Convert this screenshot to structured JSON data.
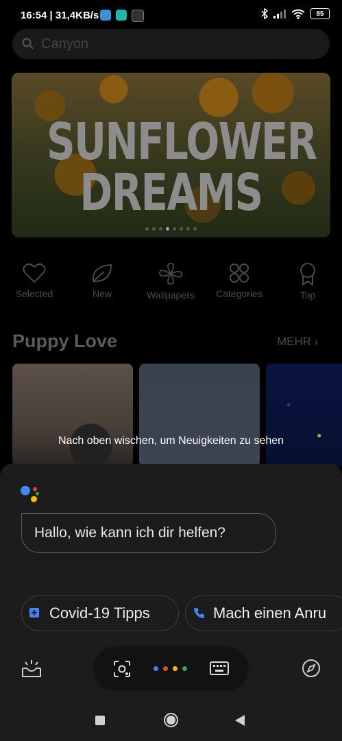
{
  "status_bar": {
    "time": "16:54",
    "speed": "| 31,4KB/s",
    "battery": "85"
  },
  "search": {
    "placeholder": "Canyon"
  },
  "banner": {
    "line1": "SUNFLOWER",
    "line2": "DREAMS",
    "page_count": 8,
    "active_page": 3
  },
  "quick_nav": [
    {
      "label": "Selected",
      "icon": "heart-icon"
    },
    {
      "label": "New",
      "icon": "leaf-icon"
    },
    {
      "label": "Wallpapers",
      "icon": "pinwheel-icon"
    },
    {
      "label": "Categories",
      "icon": "grid-icon"
    },
    {
      "label": "Top",
      "icon": "badge-icon"
    }
  ],
  "section": {
    "title": "Puppy Love",
    "more": "MEHR"
  },
  "swipe_hint": "Nach oben wischen, um Neuigkeiten zu sehen",
  "assistant": {
    "greeting": "Hallo, wie kann ich dir helfen?",
    "chips": [
      {
        "label": "Covid-19 Tipps",
        "icon": "plus-square-icon"
      },
      {
        "label": "Mach einen Anru",
        "icon": "phone-icon"
      }
    ],
    "dot_colors": [
      "#4285F4",
      "#EA4335",
      "#FBBC05",
      "#34A853"
    ]
  }
}
